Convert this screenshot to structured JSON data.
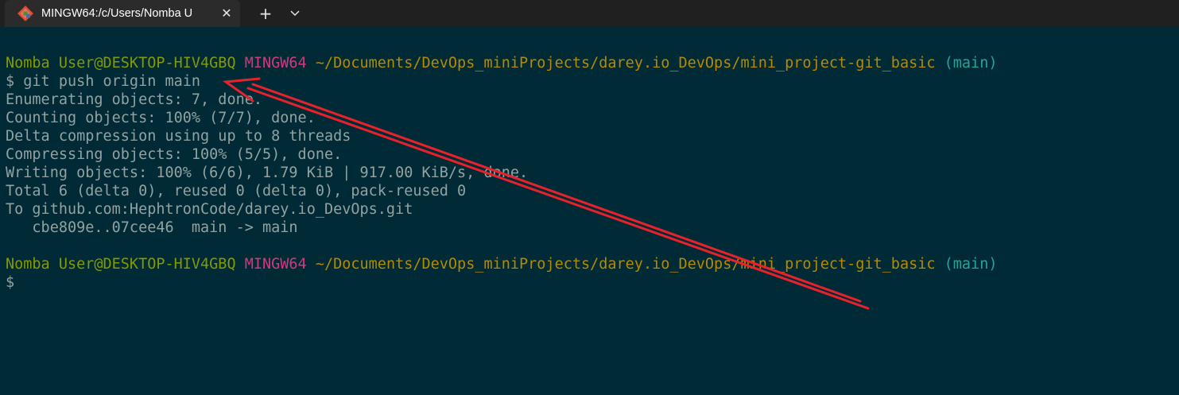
{
  "window": {
    "tab_title": "MINGW64:/c/Users/Nomba U",
    "tab_close_glyph": "✕",
    "new_tab_glyph": "+",
    "tab_icon": "git-bash-icon",
    "dropdown_icon": "chevron-down-icon"
  },
  "terminal": {
    "prompt1": {
      "user_host": "Nomba User@DESKTOP-HIV4GBQ",
      "shell": "MINGW64",
      "path": "~/Documents/DevOps_miniProjects/darey.io_DevOps/mini_project-git_basic",
      "branch": "(main)"
    },
    "command_line": "$ git push origin main",
    "output": [
      "Enumerating objects: 7, done.",
      "Counting objects: 100% (7/7), done.",
      "Delta compression using up to 8 threads",
      "Compressing objects: 100% (5/5), done.",
      "Writing objects: 100% (6/6), 1.79 KiB | 917.00 KiB/s, done.",
      "Total 6 (delta 0), reused 0 (delta 0), pack-reused 0",
      "To github.com:HephtronCode/darey.io_DevOps.git",
      "   cbe809e..07cee46  main -> main"
    ],
    "prompt2": {
      "user_host": "Nomba User@DESKTOP-HIV4GBQ",
      "shell": "MINGW64",
      "path": "~/Documents/DevOps_miniProjects/darey.io_DevOps/mini_project-git_basic",
      "branch": "(main)"
    },
    "current_input": "$"
  },
  "colors": {
    "background": "#002b36",
    "user_host": "#859900",
    "shell": "#d33682",
    "path": "#b58900",
    "branch": "#2aa198",
    "text": "#93a1a1",
    "annotation_arrow": "#e8212a"
  }
}
